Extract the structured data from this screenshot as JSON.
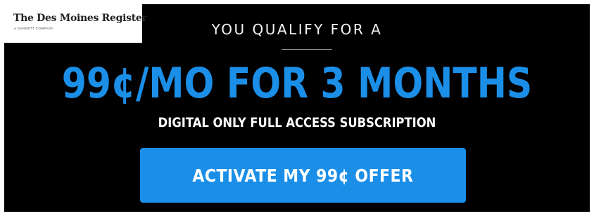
{
  "logo": {
    "name": "The Des Moines Register",
    "tagline": "A GANNETT COMPANY"
  },
  "offer": {
    "intro": "YOU QUALIFY FOR A",
    "headline": "99¢/MO FOR 3 MONTHS",
    "subheadline": "DIGITAL ONLY FULL ACCESS SUBSCRIPTION",
    "cta_label": "ACTIVATE MY 99¢ OFFER"
  },
  "colors": {
    "background": "#000000",
    "accent": "#1b8fe8",
    "text": "#ffffff"
  }
}
